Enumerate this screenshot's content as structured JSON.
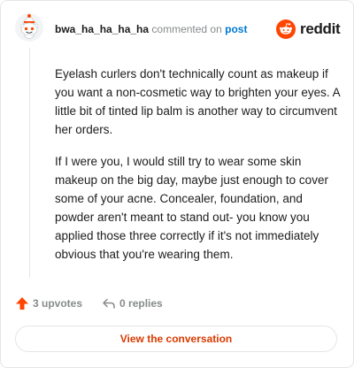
{
  "header": {
    "username": "bwa_ha_ha_ha_ha",
    "action_text": "commented on",
    "link_text": "post"
  },
  "logo": {
    "icon": "reddit-snoo-icon",
    "word": "reddit",
    "brand_color": "#ff4500"
  },
  "comment": {
    "paragraphs": [
      "Eyelash curlers don't technically count as makeup if you want a non-cosmetic way to brighten your eyes. A little bit of tinted lip balm is another way to circumvent her orders.",
      "If I were you, I would still try to wear some skin makeup on the big day, maybe just enough to cover some of your acne. Concealer, foundation, and powder aren't meant to stand out- you know you applied those three correctly if it's not immediately obvious that you're wearing them."
    ]
  },
  "actions": {
    "upvotes": "3 upvotes",
    "upvote_icon": "upvote-arrow-icon",
    "upvote_color": "#ff4500",
    "replies": "0 replies",
    "reply_icon": "reply-arrow-icon"
  },
  "cta": {
    "label": "View the conversation",
    "color": "#d93a00"
  }
}
